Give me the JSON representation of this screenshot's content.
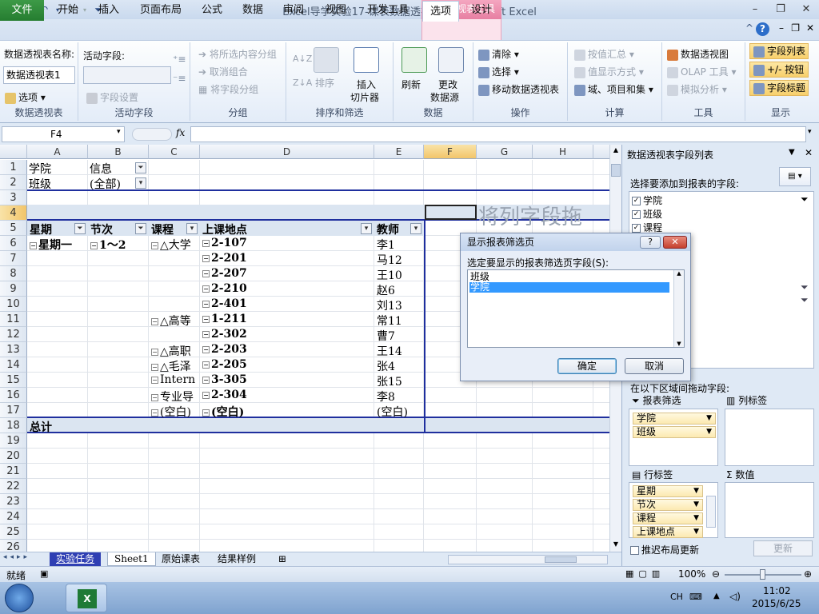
{
  "window": {
    "title": "Excel导学实验17-课表数据透视表1 - Microsoft Excel",
    "context_tools": "数据透视表工具"
  },
  "tabs": [
    "文件",
    "开始",
    "插入",
    "页面布局",
    "公式",
    "数据",
    "审阅",
    "视图",
    "开发工具",
    "选项",
    "设计"
  ],
  "ribbon": {
    "pt_name_label": "数据透视表名称:",
    "pt_name_value": "数据透视表1",
    "options_label": "选项",
    "group_pivot": "数据透视表",
    "active_field_label": "活动字段:",
    "field_settings": "字段设置",
    "group_active": "活动字段",
    "group_selection": "将所选内容分组",
    "ungroup": "取消组合",
    "group_field": "将字段分组",
    "group_group": "分组",
    "sort": "排序",
    "insert_slicer_1": "插入",
    "insert_slicer_2": "切片器",
    "group_sort": "排序和筛选",
    "refresh": "刷新",
    "change_source_1": "更改",
    "change_source_2": "数据源",
    "group_data": "数据",
    "clear": "清除",
    "select": "选择",
    "move_pt": "移动数据透视表",
    "group_actions": "操作",
    "summarize_by": "按值汇总",
    "show_values_as": "值显示方式",
    "fields_items": "域、项目和集",
    "group_calc": "计算",
    "pivot_chart": "数据透视图",
    "olap_tools": "OLAP 工具",
    "what_if": "模拟分析",
    "group_tools": "工具",
    "field_list": "字段列表",
    "buttons": "+/- 按钮",
    "field_headers": "字段标题",
    "group_show": "显示"
  },
  "formula_bar": {
    "name_box": "F4",
    "fx": "fx",
    "formula": ""
  },
  "columns": [
    "A",
    "B",
    "C",
    "D",
    "E",
    "F",
    "G",
    "H"
  ],
  "rows": [
    "1",
    "2",
    "3",
    "4",
    "5",
    "6",
    "7",
    "8",
    "9",
    "10",
    "11",
    "12",
    "13",
    "14",
    "15",
    "16",
    "17",
    "18",
    "19",
    "20",
    "21",
    "22",
    "23",
    "24",
    "25",
    "26"
  ],
  "filters": [
    {
      "field": "学院",
      "value": "信息"
    },
    {
      "field": "班级",
      "value": "(全部)"
    }
  ],
  "pivot_headers": [
    "星期",
    "节次",
    "课程",
    "上课地点",
    "教师"
  ],
  "pivot_rows": [
    {
      "day": "星期一",
      "period": "1～2",
      "course": "△大学",
      "room": "2-107",
      "teacher": "李1"
    },
    {
      "day": "",
      "period": "",
      "course": "",
      "room": "2-201",
      "teacher": "马12"
    },
    {
      "day": "",
      "period": "",
      "course": "",
      "room": "2-207",
      "teacher": "王10"
    },
    {
      "day": "",
      "period": "",
      "course": "",
      "room": "2-210",
      "teacher": "赵6"
    },
    {
      "day": "",
      "period": "",
      "course": "",
      "room": "2-401",
      "teacher": "刘13"
    },
    {
      "day": "",
      "period": "",
      "course": "△高等",
      "room": "1-211",
      "teacher": "常11"
    },
    {
      "day": "",
      "period": "",
      "course": "",
      "room": "2-302",
      "teacher": "曹7"
    },
    {
      "day": "",
      "period": "",
      "course": "△高职",
      "room": "2-203",
      "teacher": "王14"
    },
    {
      "day": "",
      "period": "",
      "course": "△毛泽",
      "room": "2-205",
      "teacher": "张4"
    },
    {
      "day": "",
      "period": "",
      "course": "Intern",
      "room": "3-305",
      "teacher": "张15"
    },
    {
      "day": "",
      "period": "",
      "course": "专业导",
      "room": "2-304",
      "teacher": "李8"
    },
    {
      "day": "",
      "period": "",
      "course": "(空白)",
      "room": "(空白)",
      "teacher": "(空白)"
    }
  ],
  "grand_total": "总计",
  "col_drop_hint": "将列字段拖",
  "sheet_tabs": [
    "实验任务",
    "Sheet1",
    "原始课表",
    "结果样例"
  ],
  "status": {
    "ready": "就绪",
    "zoom": "100%"
  },
  "field_pane": {
    "title": "数据透视表字段列表",
    "choose_label": "选择要添加到报表的字段:",
    "fields": [
      {
        "name": "学院",
        "checked": true,
        "filtered": true
      },
      {
        "name": "班级",
        "checked": true,
        "filtered": false
      },
      {
        "name": "课程",
        "checked": true,
        "filtered": false
      }
    ],
    "drag_label": "在以下区域间拖动字段:",
    "area_filter": "报表筛选",
    "area_columns": "列标签",
    "area_rows": "行标签",
    "area_values": "数值",
    "filter_fields": [
      "学院",
      "班级"
    ],
    "row_fields": [
      "星期",
      "节次",
      "课程",
      "上课地点"
    ],
    "defer_update": "推迟布局更新",
    "update_btn": "更新"
  },
  "dialog": {
    "title": "显示报表筛选页",
    "prompt": "选定要显示的报表筛选页字段(S):",
    "items": [
      "班级",
      "学院"
    ],
    "selected_index": 1,
    "ok": "确定",
    "cancel": "取消"
  },
  "taskbar": {
    "lang": "CH",
    "time": "11:02",
    "date": "2015/6/25"
  }
}
